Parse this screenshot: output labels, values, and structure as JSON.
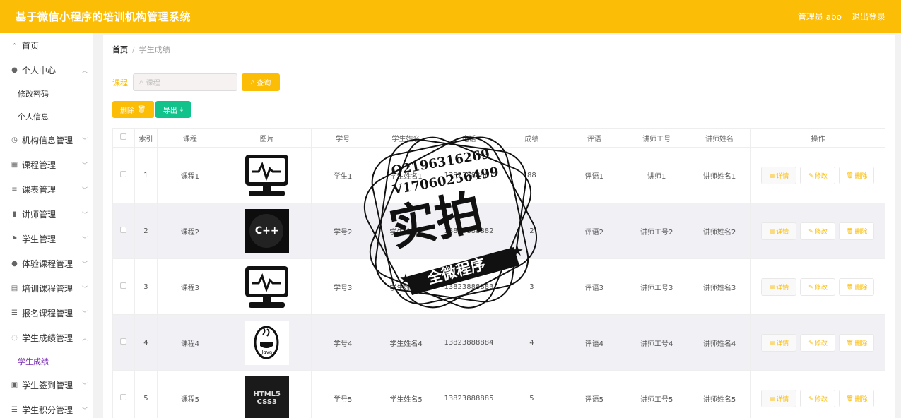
{
  "app": {
    "title": "基于微信小程序的培训机构管理系统",
    "user": "管理员 abo",
    "logout": "退出登录"
  },
  "sidebar": {
    "items": [
      {
        "label": "首页",
        "icon": "home-icon",
        "glyph": "⌂"
      },
      {
        "label": "个人中心",
        "icon": "user-icon",
        "glyph": "●",
        "expanded": true,
        "children": [
          {
            "label": "修改密码"
          },
          {
            "label": "个人信息"
          }
        ]
      },
      {
        "label": "机构信息管理",
        "icon": "clock-icon",
        "glyph": "◷"
      },
      {
        "label": "课程管理",
        "icon": "grid-icon",
        "glyph": "▦"
      },
      {
        "label": "课表管理",
        "icon": "stack-icon",
        "glyph": "≡"
      },
      {
        "label": "讲师管理",
        "icon": "bars-icon",
        "glyph": "▮"
      },
      {
        "label": "学生管理",
        "icon": "flag-icon",
        "glyph": "⚑"
      },
      {
        "label": "体验课程管理",
        "icon": "pin-icon",
        "glyph": "●"
      },
      {
        "label": "培训课程管理",
        "icon": "print-icon",
        "glyph": "▤"
      },
      {
        "label": "报名课程管理",
        "icon": "sliders-icon",
        "glyph": "☰"
      },
      {
        "label": "学生成绩管理",
        "icon": "circle-icon",
        "glyph": "◌",
        "expanded": true,
        "children": [
          {
            "label": "学生成绩",
            "active": true
          }
        ]
      },
      {
        "label": "学生签到管理",
        "icon": "chart-icon",
        "glyph": "▣"
      },
      {
        "label": "学生积分管理",
        "icon": "list-icon",
        "glyph": "☰"
      }
    ]
  },
  "breadcrumb": {
    "home": "首页",
    "sep": "/",
    "current": "学生成绩"
  },
  "search": {
    "label": "课程",
    "placeholder": "课程",
    "button": "查询"
  },
  "actions": {
    "delete": "删除",
    "export": "导出"
  },
  "table": {
    "headers": [
      "",
      "索引",
      "课程",
      "图片",
      "学号",
      "学生姓名",
      "电话",
      "成绩",
      "评语",
      "讲师工号",
      "讲师姓名",
      "操作"
    ],
    "ops": {
      "detail": "详情",
      "edit": "修改",
      "delete": "删除"
    },
    "rows": [
      {
        "index": "1",
        "course": "课程1",
        "image": "monitor",
        "sid": "学生1",
        "sname": "学生姓名1",
        "phone": "13823888881",
        "score": "88",
        "comment": "评语1",
        "tid": "讲师1",
        "tname": "讲师姓名1"
      },
      {
        "index": "2",
        "course": "课程2",
        "image": "cpp",
        "sid": "学号2",
        "sname": "学生姓名2",
        "phone": "13823888882",
        "score": "2",
        "comment": "评语2",
        "tid": "讲师工号2",
        "tname": "讲师姓名2"
      },
      {
        "index": "3",
        "course": "课程3",
        "image": "monitor",
        "sid": "学号3",
        "sname": "学生姓名3",
        "phone": "13823888883",
        "score": "3",
        "comment": "评语3",
        "tid": "讲师工号3",
        "tname": "讲师姓名3"
      },
      {
        "index": "4",
        "course": "课程4",
        "image": "java",
        "sid": "学号4",
        "sname": "学生姓名4",
        "phone": "13823888884",
        "score": "4",
        "comment": "评语4",
        "tid": "讲师工号4",
        "tname": "讲师姓名4"
      },
      {
        "index": "5",
        "course": "课程5",
        "image": "html5",
        "sid": "学号5",
        "sname": "学生姓名5",
        "phone": "13823888885",
        "score": "5",
        "comment": "评语5",
        "tid": "讲师工号5",
        "tname": "讲师姓名5"
      }
    ]
  },
  "thumb_text": {
    "cpp": "C++",
    "java": "Java",
    "html5": "HTML5",
    "css3": "CSS3"
  },
  "stamp": {
    "line1": "Q2196316269",
    "line2": "V17060256499",
    "main": "实拍",
    "ribbon": "全微程序"
  },
  "colors": {
    "brand": "#fcbd07",
    "export": "#11c38a",
    "active": "#7b2fb5"
  }
}
